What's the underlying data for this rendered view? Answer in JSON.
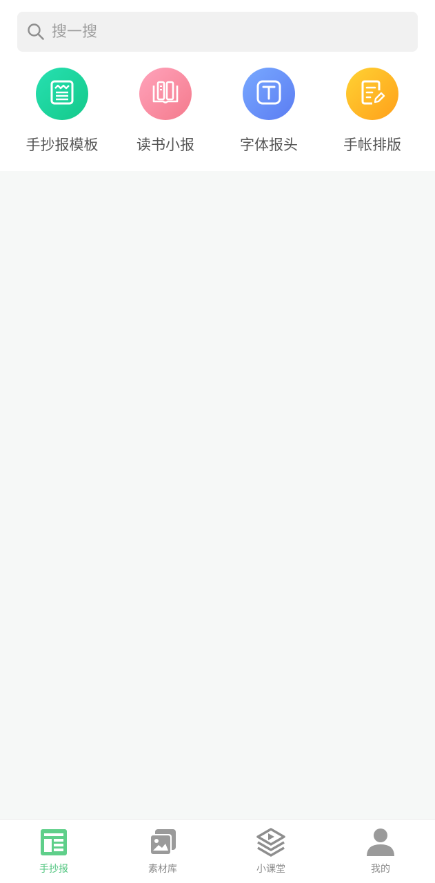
{
  "search": {
    "placeholder": "搜一搜",
    "icon": "search-icon"
  },
  "categories": [
    {
      "label": "手抄报模板",
      "icon": "newspaper-icon",
      "colors": [
        "#27e0b1",
        "#14c98a"
      ]
    },
    {
      "label": "读书小报",
      "icon": "open-book-icon",
      "colors": [
        "#ffa3bb",
        "#f47a8c"
      ]
    },
    {
      "label": "字体报头",
      "icon": "text-t-icon",
      "colors": [
        "#78a9ff",
        "#5b7cf2"
      ]
    },
    {
      "label": "手帐排版",
      "icon": "note-edit-icon",
      "colors": [
        "#ffd233",
        "#ffa01a"
      ]
    }
  ],
  "tabbar": {
    "active_color": "#4fc47e",
    "inactive_color": "#8a8a8a",
    "tabs": [
      {
        "label": "手抄报",
        "icon": "newspaper-tab-icon",
        "active": true
      },
      {
        "label": "素材库",
        "icon": "gallery-icon",
        "active": false
      },
      {
        "label": "小课堂",
        "icon": "play-class-icon",
        "active": false
      },
      {
        "label": "我的",
        "icon": "user-icon",
        "active": false
      }
    ]
  }
}
